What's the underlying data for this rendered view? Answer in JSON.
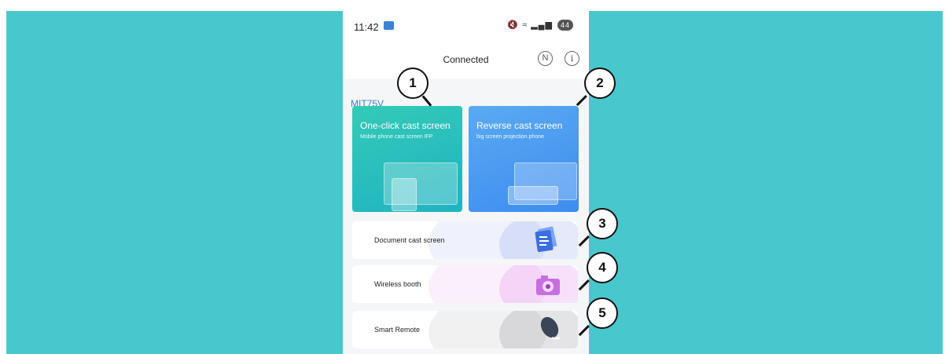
{
  "status_bar": {
    "time": "11:42",
    "battery": "44"
  },
  "app_bar": {
    "title": "Connected",
    "n_icon_glyph": "N",
    "info_icon_glyph": "i"
  },
  "device_name": "MIT75V",
  "cards": {
    "one_click": {
      "title": "One-click cast screen",
      "subtitle": "Mobile phone cast screen IFP"
    },
    "reverse": {
      "title": "Reverse cast screen",
      "subtitle": "big screen projection phone"
    }
  },
  "list_cards": [
    {
      "label": "Document cast screen"
    },
    {
      "label": "Wireless booth"
    },
    {
      "label": "Smart Remote"
    }
  ],
  "callouts": [
    "1",
    "2",
    "3",
    "4",
    "5"
  ],
  "colors": {
    "background": "#48c8cc",
    "device_name": "#3d80c8",
    "one_click_card": "#2ec3b8",
    "reverse_card": "#4c9ef2"
  }
}
